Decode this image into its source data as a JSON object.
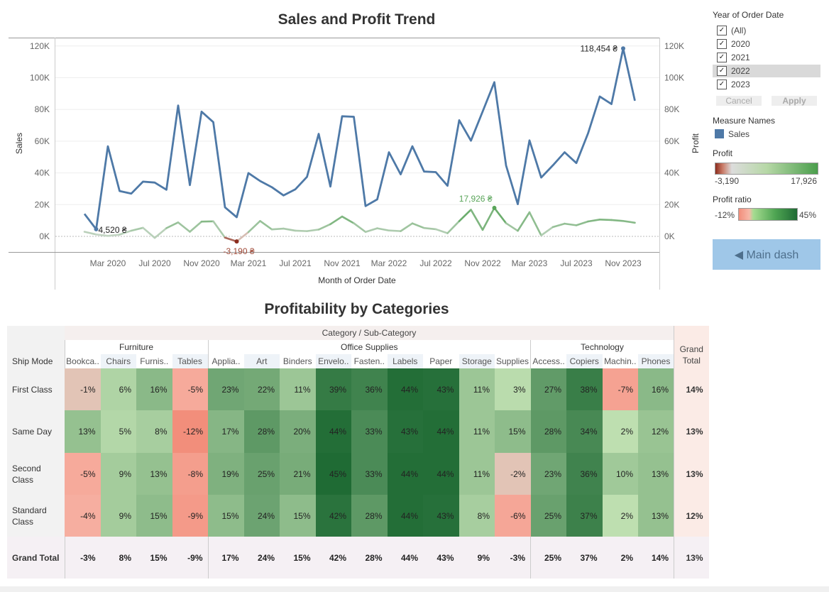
{
  "line_chart": {
    "title": "Sales and Profit Trend",
    "x_label": "Month of Order Date",
    "y_left_label": "Sales",
    "y_right_label": "Profit",
    "y_ticks": [
      "0K",
      "20K",
      "40K",
      "60K",
      "80K",
      "100K",
      "120K"
    ],
    "x_ticks": [
      "Mar 2020",
      "Jul 2020",
      "Nov 2020",
      "Mar 2021",
      "Jul 2021",
      "Nov 2021",
      "Mar 2022",
      "Jul 2022",
      "Nov 2022",
      "Mar 2023",
      "Jul 2023",
      "Nov 2023"
    ],
    "annotations": {
      "sales_max": "118,454 ₴",
      "sales_min": "4,520 ₴",
      "profit_max": "17,926 ₴",
      "profit_min": "-3,190 ₴"
    }
  },
  "chart_data": [
    {
      "type": "line",
      "title": "Sales and Profit Trend",
      "xlabel": "Month of Order Date",
      "ylabel": "Sales",
      "ylim": [
        -10000,
        120000
      ],
      "x": [
        "2020-01",
        "2020-02",
        "2020-03",
        "2020-04",
        "2020-05",
        "2020-06",
        "2020-07",
        "2020-08",
        "2020-09",
        "2020-10",
        "2020-11",
        "2020-12",
        "2021-01",
        "2021-02",
        "2021-03",
        "2021-04",
        "2021-05",
        "2021-06",
        "2021-07",
        "2021-08",
        "2021-09",
        "2021-10",
        "2021-11",
        "2021-12",
        "2022-01",
        "2022-02",
        "2022-03",
        "2022-04",
        "2022-05",
        "2022-06",
        "2022-07",
        "2022-08",
        "2022-09",
        "2022-10",
        "2022-11",
        "2022-12",
        "2023-01",
        "2023-02",
        "2023-03",
        "2023-04",
        "2023-05",
        "2023-06",
        "2023-07",
        "2023-08",
        "2023-09",
        "2023-10",
        "2023-11",
        "2023-12"
      ],
      "series": [
        {
          "name": "Sales",
          "values": [
            14200,
            4520,
            56800,
            28600,
            27000,
            34500,
            33900,
            29400,
            82500,
            32300,
            78600,
            72000,
            18300,
            12100,
            39900,
            34900,
            31000,
            25800,
            29600,
            37500,
            64600,
            31400,
            75700,
            75400,
            19100,
            23300,
            53000,
            39100,
            56800,
            40900,
            40500,
            31900,
            73200,
            60300,
            78700,
            97200,
            44700,
            20300,
            60500,
            37100,
            44800,
            53000,
            46200,
            64900,
            88200,
            83400,
            118454,
            85500
          ]
        },
        {
          "name": "Profit",
          "values": [
            2900,
            1200,
            300,
            1100,
            3600,
            5400,
            -950,
            5200,
            8800,
            2900,
            9300,
            9500,
            -800,
            -3190,
            2700,
            9700,
            4400,
            4900,
            3600,
            3300,
            4300,
            7700,
            12500,
            8300,
            2800,
            5100,
            3700,
            3300,
            8200,
            5300,
            4500,
            2000,
            9600,
            16800,
            4100,
            17926,
            8300,
            3500,
            15200,
            600,
            5900,
            8000,
            7000,
            9400,
            10600,
            10300,
            9700,
            8600
          ]
        }
      ]
    },
    {
      "type": "heatmap",
      "title": "Profitability by Categories",
      "row_header": "Ship Mode",
      "column_header": "Category / Sub-Category",
      "categories": [
        "Furniture",
        "Office Supplies",
        "Technology"
      ],
      "columns": [
        "Bookca..",
        "Chairs",
        "Furnis..",
        "Tables",
        "Applia..",
        "Art",
        "Binders",
        "Envelo..",
        "Fasten..",
        "Labels",
        "Paper",
        "Storage",
        "Supplies",
        "Access..",
        "Copiers",
        "Machin..",
        "Phones"
      ],
      "rows": [
        "First Class",
        "Same Day",
        "Second Class",
        "Standard Class",
        "Grand Total"
      ],
      "values": [
        [
          -1,
          6,
          16,
          -5,
          23,
          22,
          11,
          39,
          36,
          44,
          43,
          11,
          3,
          27,
          38,
          -7,
          16
        ],
        [
          13,
          5,
          8,
          -12,
          17,
          28,
          20,
          44,
          33,
          43,
          44,
          11,
          15,
          28,
          34,
          2,
          12
        ],
        [
          -5,
          9,
          13,
          -8,
          19,
          25,
          21,
          45,
          33,
          44,
          44,
          11,
          -2,
          23,
          36,
          10,
          13
        ],
        [
          -4,
          9,
          15,
          -9,
          15,
          24,
          15,
          42,
          28,
          44,
          43,
          8,
          -6,
          25,
          37,
          2,
          13
        ],
        [
          -3,
          8,
          15,
          -9,
          17,
          24,
          15,
          42,
          28,
          44,
          43,
          9,
          -3,
          25,
          37,
          2,
          14
        ]
      ],
      "grand_total_column": [
        14,
        13,
        13,
        12,
        13
      ],
      "grand_total_label": "Grand Total",
      "unit": "%"
    }
  ],
  "table": {
    "title": "Profitability by Categories",
    "column_header": "Category / Sub-Category",
    "row_header": "Ship Mode",
    "grand_total_label": "Grand Total"
  },
  "filters": {
    "year_title": "Year of Order Date",
    "years": [
      {
        "label": "(All)",
        "checked": true
      },
      {
        "label": "2020",
        "checked": true
      },
      {
        "label": "2021",
        "checked": true
      },
      {
        "label": "2022",
        "checked": true,
        "highlighted": true
      },
      {
        "label": "2023",
        "checked": true
      }
    ],
    "cancel_label": "Cancel",
    "apply_label": "Apply",
    "measure_title": "Measure Names",
    "measure_item": "Sales",
    "profit_title": "Profit",
    "profit_min": "-3,190",
    "profit_max": "17,926",
    "ratio_title": "Profit ratio",
    "ratio_min": "-12%",
    "ratio_max": "45%",
    "main_dash_label": "◀ Main dash"
  },
  "colors": {
    "sales_line": "#4e79a7",
    "negative": "#f28e7b",
    "positive_dark": "#1f6b34",
    "panel_button": "#9fc7e8"
  }
}
